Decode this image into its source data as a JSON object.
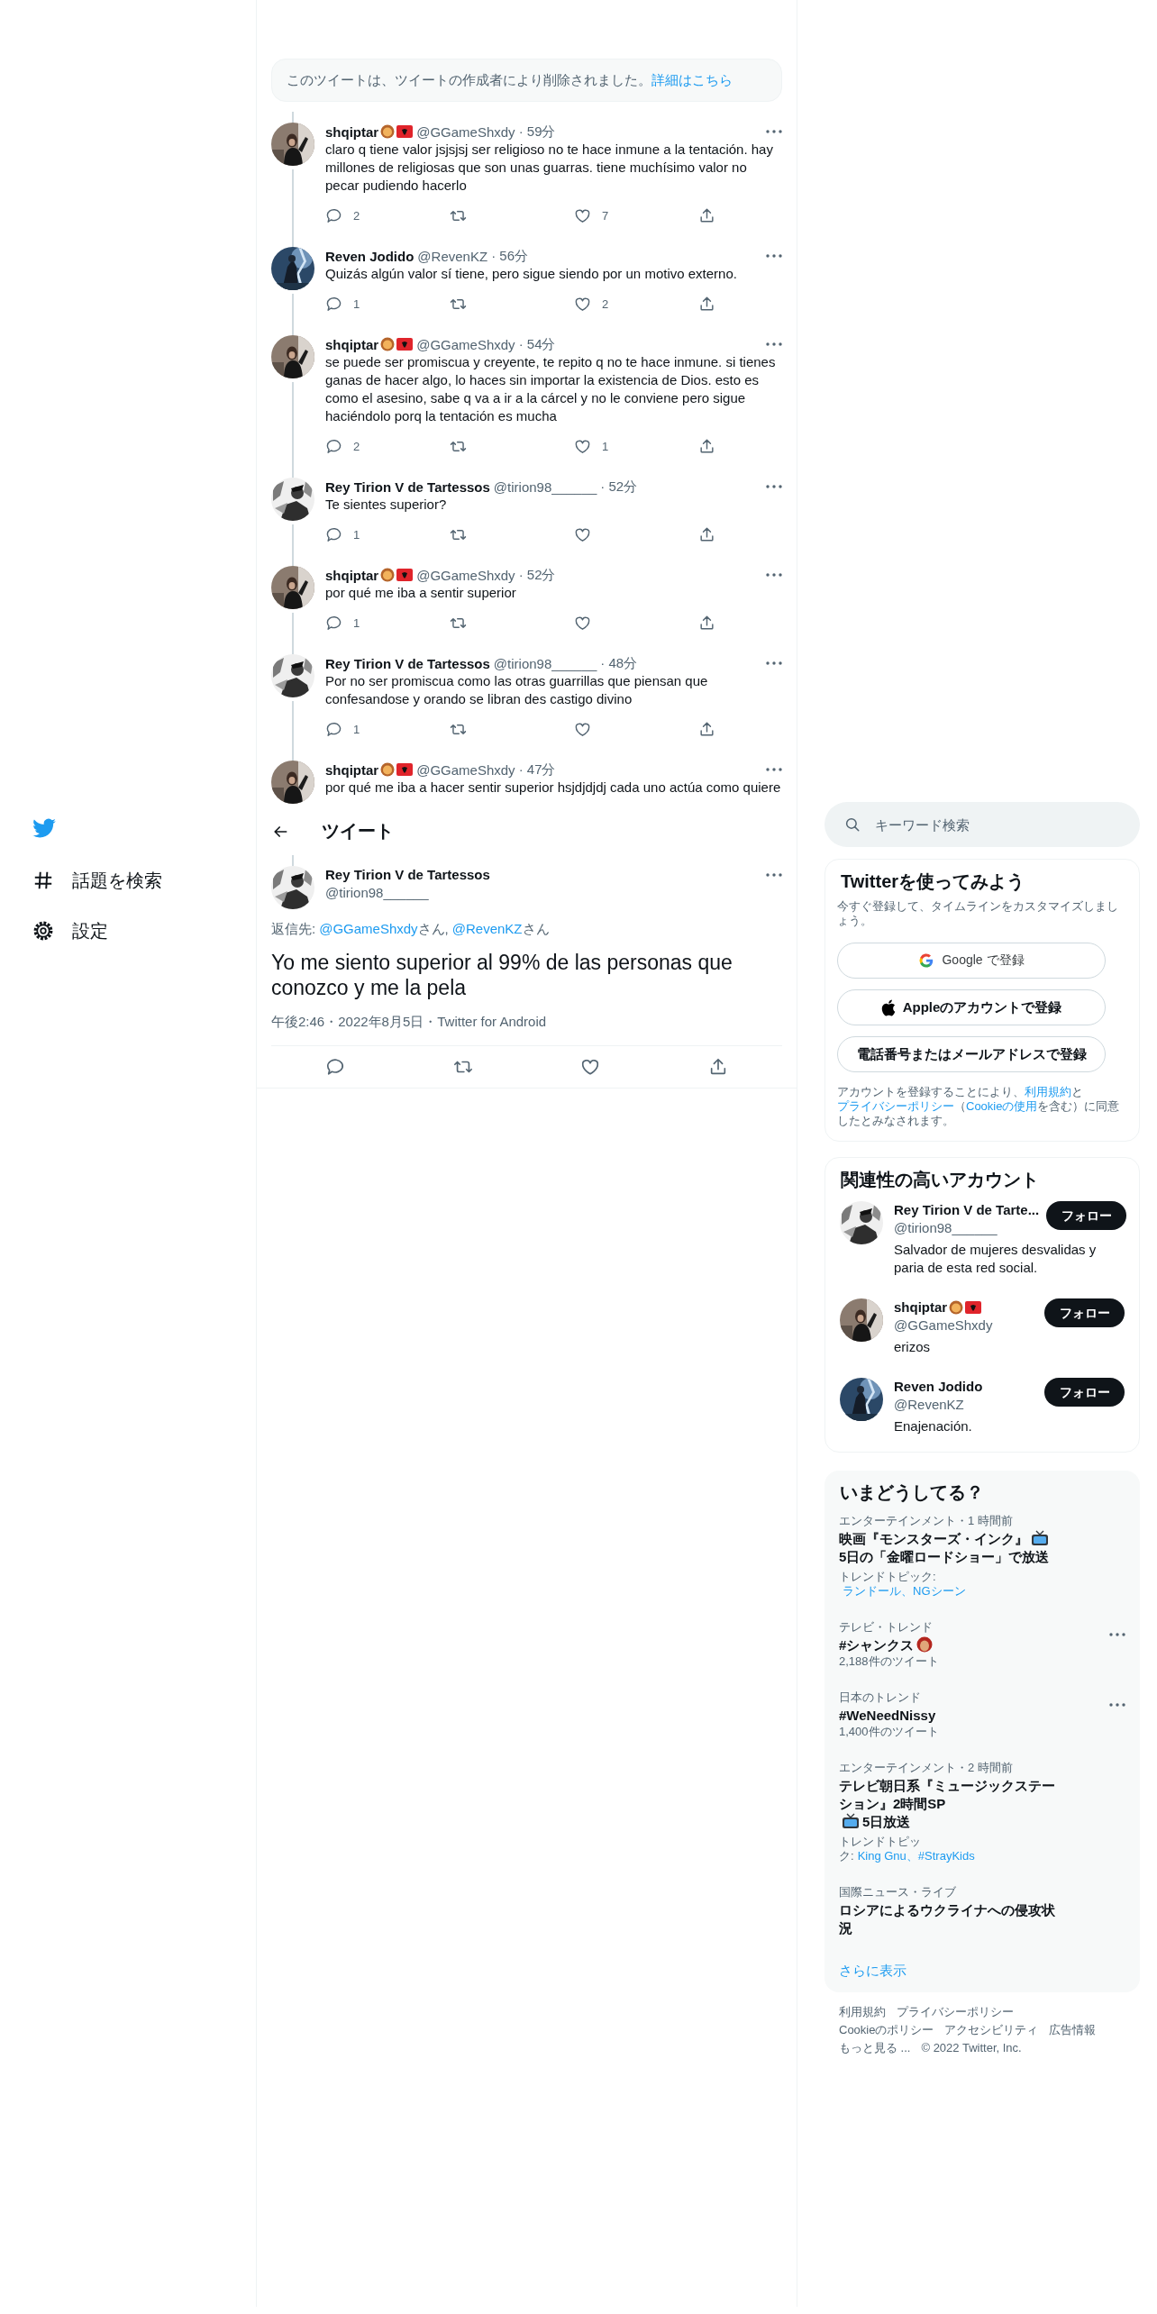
{
  "left_nav": {
    "items": [
      {
        "kind": "explore",
        "label": "話題を検索"
      },
      {
        "kind": "settings",
        "label": "設定"
      }
    ]
  },
  "thread": {
    "deleted_notice": {
      "text": "このツイートは、ツイートの作成者により削除されました。",
      "link": "詳細はこちら"
    },
    "replies": [
      {
        "name": "shqiptar",
        "badges": true,
        "handle": "@GGameShxdy",
        "time": "· 59分",
        "text": "claro q tiene valor jsjsjsj ser religioso no te hace inmune a la tentación. hay millones de religiosas que son unas guarras. tiene muchísimo valor no pecar pudiendo hacerlo",
        "actions": {
          "reply": "2",
          "like": "7"
        }
      },
      {
        "name": "Reven Jodido",
        "badges": false,
        "handle": "@RevenKZ",
        "time": "· 56分",
        "text": "Quizás algún valor sí tiene, pero sigue siendo por un motivo externo.",
        "actions": {
          "reply": "1",
          "like": "2"
        }
      },
      {
        "name": "shqiptar",
        "badges": true,
        "handle": "@GGameShxdy",
        "time": "· 54分",
        "text": "se puede ser promiscua y creyente, te repito q no te hace inmune. si tienes ganas de hacer algo, lo haces sin importar la existencia de Dios. esto es como el asesino, sabe q va a ir a la cárcel y no le conviene pero sigue haciéndolo porq la tentación es mucha",
        "actions": {
          "reply": "2",
          "like": "1"
        }
      },
      {
        "name": "Rey Tirion V de Tartessos",
        "badges": false,
        "handle": "@tirion98______",
        "time": "· 52分",
        "text": "Te sientes superior?",
        "actions": {
          "reply": "1"
        }
      },
      {
        "name": "shqiptar",
        "badges": true,
        "handle": "@GGameShxdy",
        "time": "· 52分",
        "text": "por qué me iba a sentir superior",
        "actions": {
          "reply": "1"
        }
      },
      {
        "name": "Rey Tirion V de Tartessos",
        "badges": false,
        "handle": "@tirion98______",
        "time": "· 48分",
        "text": "Por no ser promiscua como las otras guarrillas que piensan que confesandose y orando se libran des castigo divino",
        "actions": {
          "reply": "1"
        }
      },
      {
        "name": "shqiptar",
        "badges": true,
        "handle": "@GGameShxdy",
        "time": "· 47分",
        "text": "por qué me iba a hacer sentir superior hsjdjdjdj cada uno actúa como quiere"
      }
    ]
  },
  "header": {
    "title": "ツイート"
  },
  "main_tweet": {
    "name": "Rey Tirion V de Tartessos",
    "handle": "@tirion98______",
    "reply_to": [
      {
        "kind": "text",
        "text": "返信先:"
      },
      {
        "kind": "link",
        "text": "@GGameShxdy"
      },
      {
        "kind": "text",
        "text": "さん,"
      },
      {
        "kind": "link",
        "text": "@RevenKZ"
      },
      {
        "kind": "text",
        "text": "さん"
      }
    ],
    "text": "Yo me siento superior al 99% de las personas que conozco y me la pela",
    "meta": "午後2:46・2022年8月5日・Twitter for Android"
  },
  "sidebar": {
    "search": {
      "placeholder": "キーワード検索"
    },
    "signup": {
      "title": "Twitterを使ってみよう",
      "subtitle": "今すぐ登録して、タイムラインをカスタマイズしましょう。",
      "buttons": [
        {
          "kind": "google",
          "label": "Google で登録"
        },
        {
          "kind": "apple",
          "label": "Appleのアカウントで登録"
        },
        {
          "kind": "plain",
          "label": "電話番号またはメールアドレスで登録"
        }
      ],
      "terms": [
        {
          "kind": "text",
          "text": "アカウントを登録することにより、"
        },
        {
          "kind": "link",
          "text": "利用規約"
        },
        {
          "kind": "text",
          "text": "と"
        },
        {
          "kind": "link",
          "text": "プライバシーポリシー"
        },
        {
          "kind": "text",
          "text": "（"
        },
        {
          "kind": "link",
          "text": "Cookieの使用"
        },
        {
          "kind": "text",
          "text": "を含む）に同意したとみなされます。"
        }
      ]
    },
    "who_to_follow": {
      "title": "関連性の高いアカウント",
      "users": [
        {
          "name": "Rey Tirion V de Tarte...",
          "badges": false,
          "handle": "@tirion98______",
          "bio": "Salvador de mujeres desvalidas y paria de esta red social.",
          "button": "フォロー"
        },
        {
          "name": "shqiptar",
          "badges": true,
          "handle": "@GGameShxdy",
          "bio": "erizos",
          "button": "フォロー"
        },
        {
          "name": "Reven Jodido",
          "badges": false,
          "handle": "@RevenKZ",
          "bio": "Enajenación.",
          "button": "フォロー"
        }
      ]
    },
    "trends": {
      "title": "いまどうしてる？",
      "items": [
        {
          "context": "エンターテインメント・1 時間前",
          "title": [
            {
              "kind": "text",
              "text": "映画『モンスターズ・インク』"
            },
            {
              "kind": "tv"
            },
            {
              "kind": "text",
              "text": "5日の「金曜ロードショー」で放送"
            }
          ],
          "topics_label": "トレンドトピック:",
          "topics": "ランドール、NGシーン",
          "more": false
        },
        {
          "context": "テレビ・トレンド",
          "title": [
            {
              "kind": "text",
              "text": "#シャンクス"
            },
            {
              "kind": "face"
            }
          ],
          "count": "2,188件のツイート",
          "more": true
        },
        {
          "context": "日本のトレンド",
          "title": [
            {
              "kind": "text",
              "text": "#WeNeedNissy"
            }
          ],
          "count": "1,400件のツイート",
          "more": true
        },
        {
          "context": "エンターテインメント・2 時間前",
          "title": [
            {
              "kind": "text",
              "text": "テレビ朝日系『ミュージックステーション』2時間SP"
            },
            {
              "kind": "tv"
            },
            {
              "kind": "text",
              "text": "5日放送"
            }
          ],
          "topics_label": "トレンドトピック:",
          "topics": "King Gnu、#StrayKids",
          "more": false
        },
        {
          "context": "国際ニュース・ライブ",
          "title": [
            {
              "kind": "text",
              "text": "ロシアによるウクライナへの侵攻状況"
            }
          ],
          "more": false
        }
      ],
      "show_more": "さらに表示"
    },
    "footer": {
      "links": [
        "利用規約",
        "プライバシーポリシー",
        "Cookieのポリシー",
        "アクセシビリティ",
        "広告情報",
        "もっと見る ..."
      ],
      "copyright": "© 2022 Twitter, Inc."
    }
  }
}
